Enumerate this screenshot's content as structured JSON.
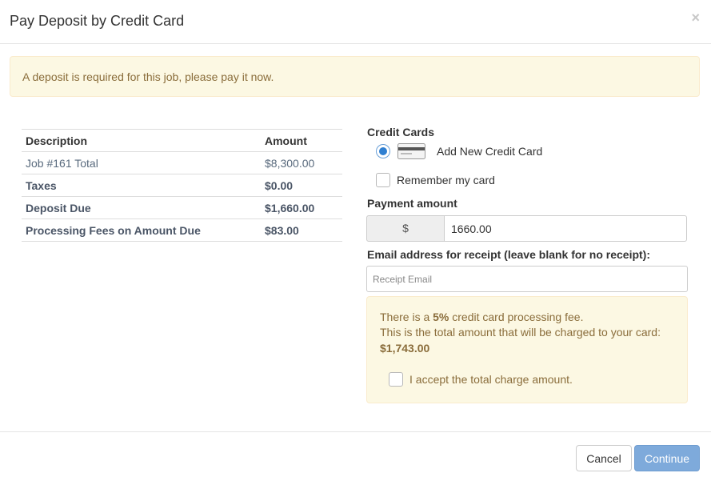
{
  "dialog": {
    "title": "Pay Deposit by Credit Card",
    "close_label": "×"
  },
  "alert": {
    "message": "A deposit is required for this job, please pay it now."
  },
  "summary": {
    "headers": [
      "Description",
      "Amount"
    ],
    "rows": [
      {
        "description": "Job #161 Total",
        "amount": "$8,300.00"
      },
      {
        "description": "Taxes",
        "amount": "$0.00"
      },
      {
        "description": "Deposit Due",
        "amount": "$1,660.00"
      },
      {
        "description": "Processing Fees on Amount Due",
        "amount": "$83.00"
      }
    ]
  },
  "credit_cards": {
    "label": "Credit Cards",
    "options": [
      {
        "label": "Add New Credit Card",
        "selected": true,
        "icon": "credit-card-icon"
      }
    ],
    "remember_label": "Remember my card",
    "remember_checked": false
  },
  "payment": {
    "label": "Payment amount",
    "currency_symbol": "$",
    "value": "1660.00"
  },
  "email": {
    "label": "Email address for receipt (leave blank for no receipt):",
    "placeholder": "Receipt Email",
    "value": ""
  },
  "fee_notice": {
    "line1_prefix": "There is a ",
    "fee_percent": "5%",
    "line1_suffix": " credit card processing fee.",
    "line2": "This is the total amount that will be charged to your card:",
    "total": "$1,743.00",
    "accept_label": "I accept the total charge amount.",
    "accept_checked": false
  },
  "footer": {
    "cancel_label": "Cancel",
    "continue_label": "Continue"
  },
  "colors": {
    "alert_bg": "#fcf8e3",
    "alert_text": "#8a6d3b",
    "primary_disabled": "#7eaadb",
    "radio_selected": "#2f7fd1"
  }
}
